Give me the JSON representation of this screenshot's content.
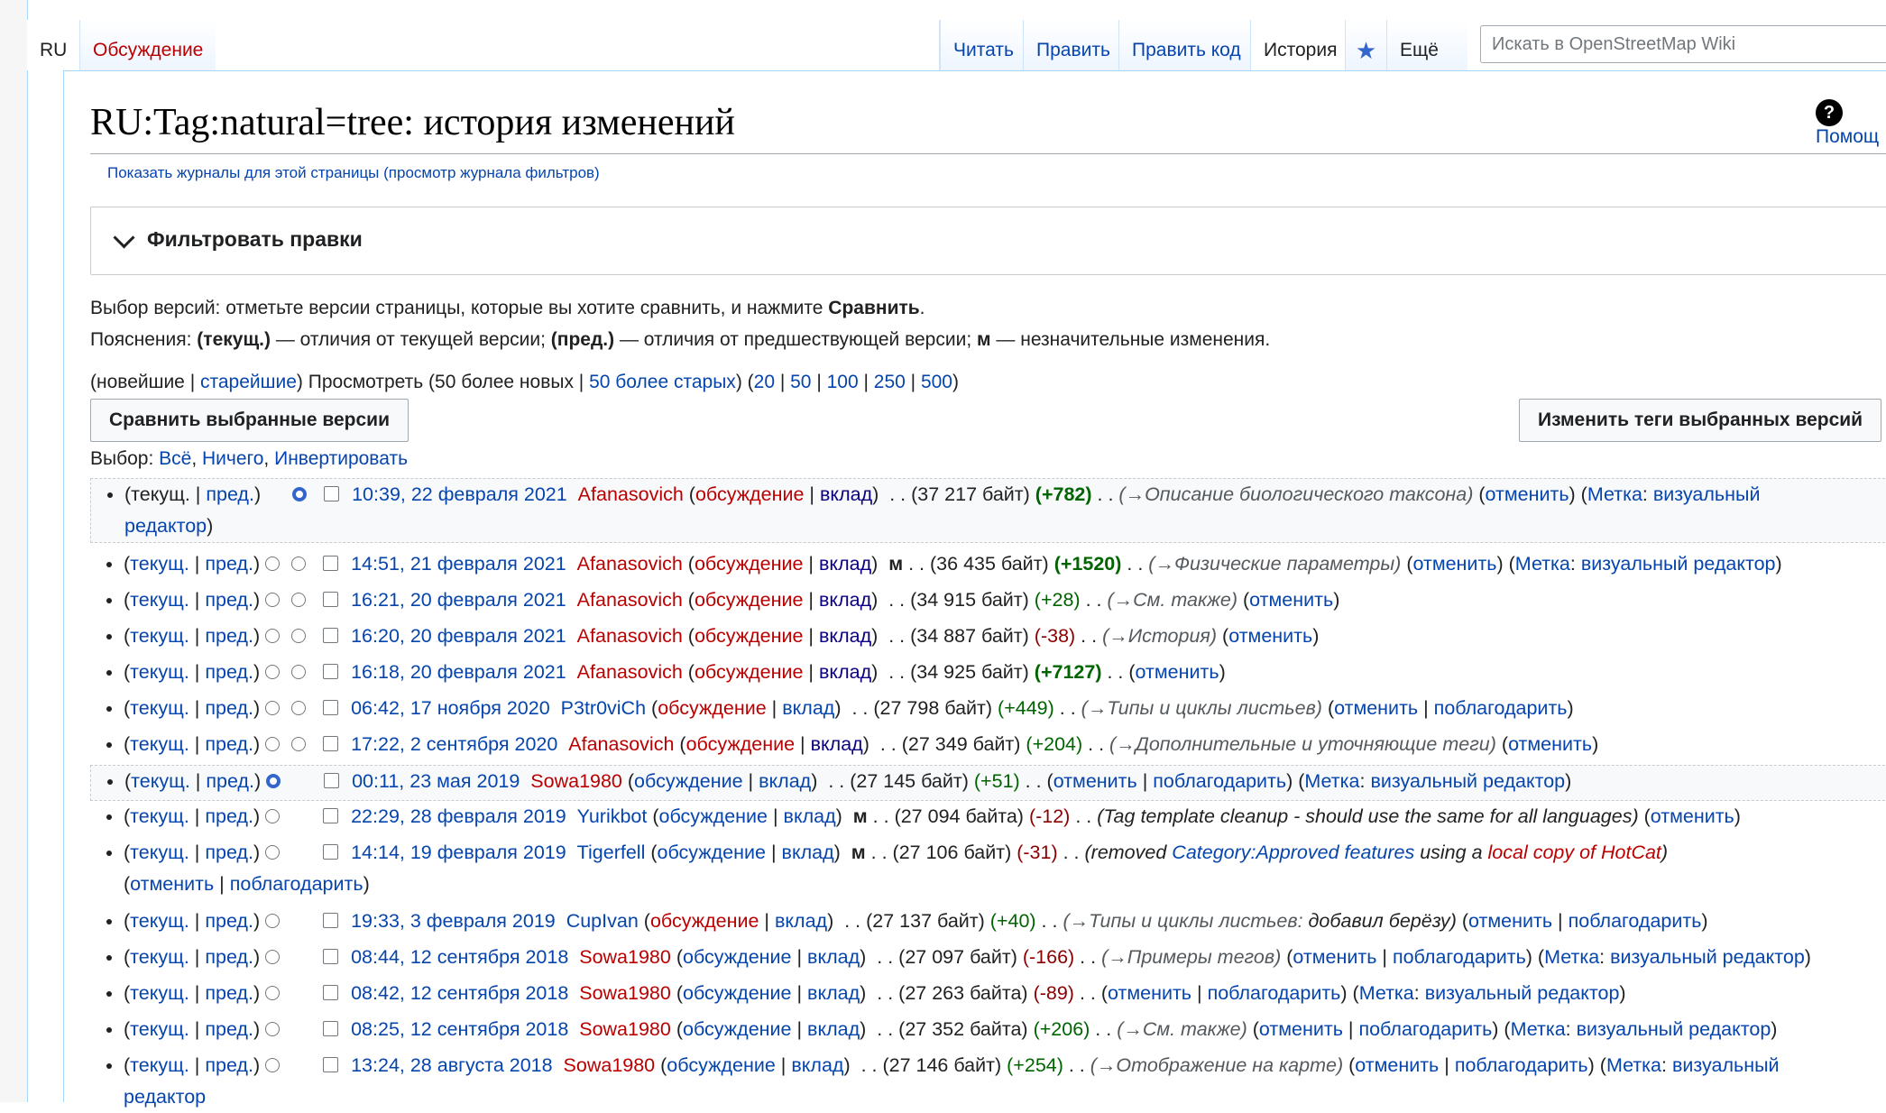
{
  "tabs": {
    "ru": "RU",
    "talk": "Обсуждение",
    "read": "Читать",
    "edit": "Править",
    "edit_source": "Править код",
    "history": "История",
    "more": "Ещё"
  },
  "search": {
    "placeholder": "Искать в OpenStreetMap Wiki"
  },
  "title": "RU:Tag:natural=tree: история изменений",
  "help": "Помощ",
  "logs_link": "Показать журналы для этой страницы (просмотр журнала фильтров)",
  "filter_title": "Фильтровать правки",
  "legend": {
    "line1_a": "Выбор версий: отметьте версии страницы, которые вы хотите сравнить, и нажмите ",
    "line1_b": "Сравнить",
    "line1_c": ".",
    "line2_a": "Пояснения: ",
    "line2_b": "(текущ.)",
    "line2_c": " — отличия от текущей версии; ",
    "line2_d": "(пред.)",
    "line2_e": " — отличия от предшествующей версии; ",
    "line2_f": "м",
    "line2_g": " — незначительные изменения."
  },
  "nav": {
    "newest": "новейшие",
    "oldest": "старейшие",
    "view": "Просмотреть (",
    "newer": "50 более новых",
    "older": "50 более старых",
    "limits": [
      "20",
      "50",
      "100",
      "250",
      "500"
    ]
  },
  "compare_btn": "Сравнить выбранные версии",
  "tags_btn": "Изменить теги выбранных версий",
  "select": {
    "label": "Выбор: ",
    "all": "Всё",
    "none": "Ничего",
    "invert": "Инвертировать"
  },
  "common": {
    "cur": "текущ.",
    "prev": "пред.",
    "talk": "обсуждение",
    "contribs": "вклад",
    "undo": "отменить",
    "thank": "поблагодарить",
    "tag_label": "Метка",
    "tag_value": "визуальный редактор",
    "minor": "м"
  },
  "revisions": [
    {
      "date": "10:39, 22 февраля 2021",
      "user": "Afanasovich",
      "size": "(37 217 байт)",
      "diff": "(+782)",
      "comment": "(→Описание биологического таксона)",
      "tag": "визуальный"
    },
    {
      "date": "14:51, 21 февраля 2021",
      "user": "Afanasovich",
      "size": "(36 435 байт)",
      "diff": "(+1520)",
      "comment": "(→Физические параметры)"
    },
    {
      "date": "16:21, 20 февраля 2021",
      "user": "Afanasovich",
      "size": "(34 915 байт)",
      "diff": "(+28)",
      "comment": "(→См. также)"
    },
    {
      "date": "16:20, 20 февраля 2021",
      "user": "Afanasovich",
      "size": "(34 887 байт)",
      "diff": "(-38)",
      "comment": "(→История)"
    },
    {
      "date": "16:18, 20 февраля 2021",
      "user": "Afanasovich",
      "size": "(34 925 байт)",
      "diff": "(+7127)"
    },
    {
      "date": "06:42, 17 ноября 2020",
      "user": "P3tr0viCh",
      "size": "(27 798 байт)",
      "diff": "(+449)",
      "comment": "(→Типы и циклы листьев)"
    },
    {
      "date": "17:22, 2 сентября 2020",
      "user": "Afanasovich",
      "size": "(27 349 байт)",
      "diff": "(+204)",
      "comment": "(→Дополнительные и уточняющие теги)"
    },
    {
      "date": "00:11, 23 мая 2019",
      "user": "Sowa1980",
      "size": "(27 145 байт)",
      "diff": "(+51)"
    },
    {
      "date": "22:29, 28 февраля 2019",
      "user": "Yurikbot",
      "size": "(27 094 байта)",
      "diff": "(-12)",
      "comment": "(Tag template cleanup - should use the same for all languages)"
    },
    {
      "date": "14:14, 19 февраля 2019",
      "user": "Tigerfell",
      "size": "(27 106 байт)",
      "diff": "(-31)",
      "comment_a": "(removed ",
      "comment_link1": "Category:Approved features",
      "comment_b": " using a ",
      "comment_link2": "local copy of HotCat",
      "comment_c": ")"
    },
    {
      "date": "19:33, 3 февраля 2019",
      "user": "CupIvan",
      "size": "(27 137 байт)",
      "diff": "(+40)",
      "comment_sec": "(→Типы и циклы листьев:",
      "comment_rest": " добавил берёзу)"
    },
    {
      "date": "08:44, 12 сентября 2018",
      "user": "Sowa1980",
      "size": "(27 097 байт)",
      "diff": "(-166)",
      "comment": "(→Примеры тегов)"
    },
    {
      "date": "08:42, 12 сентября 2018",
      "user": "Sowa1980",
      "size": "(27 263 байта)",
      "diff": "(-89)"
    },
    {
      "date": "08:25, 12 сентября 2018",
      "user": "Sowa1980",
      "size": "(27 352 байта)",
      "diff": "(+206)",
      "comment": "(→См. также)"
    },
    {
      "date": "13:24, 28 августа 2018",
      "user": "Sowa1980",
      "size": "(27 146 байт)",
      "diff": "(+254)",
      "comment": "(→Отображение на карте)",
      "tag": "визуальный"
    }
  ],
  "tail_text": "редактор"
}
